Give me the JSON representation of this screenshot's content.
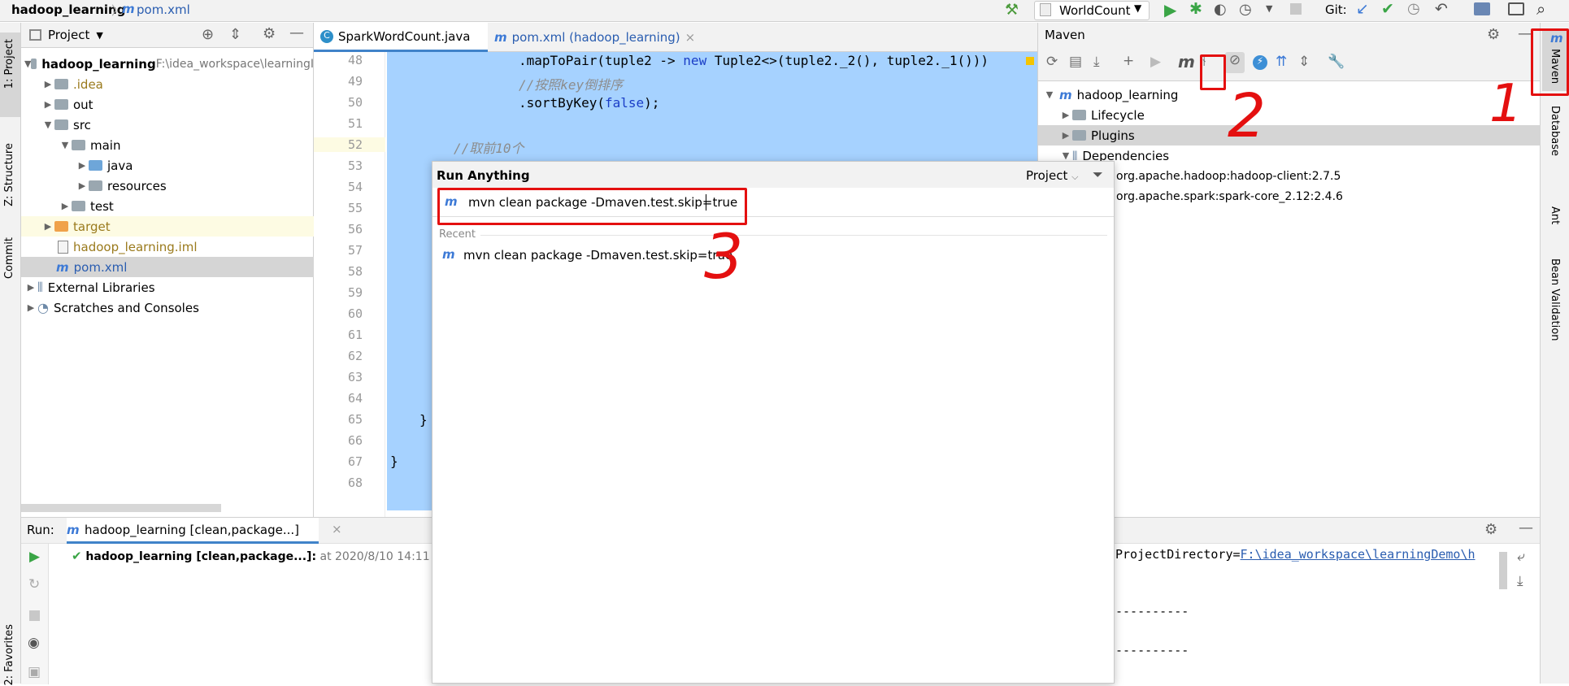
{
  "topbar": {
    "project": "hadoop_learning",
    "file": "pom.xml",
    "run_config": "WorldCount",
    "git_label": "Git:"
  },
  "left_tools": {
    "project": "1: Project",
    "structure": "Z: Structure",
    "commit": "Commit",
    "favorites": "2: Favorites"
  },
  "right_tools": {
    "maven": "Maven",
    "database": "Database",
    "ant": "Ant",
    "bean": "Bean Validation"
  },
  "project_panel": {
    "title": "Project",
    "items": [
      {
        "label": "hadoop_learning",
        "extra": "F:\\idea_workspace\\learningI",
        "indent": 0,
        "type": "module",
        "open": true
      },
      {
        "label": ".idea",
        "indent": 1,
        "type": "folder",
        "open": false
      },
      {
        "label": "out",
        "indent": 1,
        "type": "folder",
        "open": false
      },
      {
        "label": "src",
        "indent": 1,
        "type": "folder",
        "open": true
      },
      {
        "label": "main",
        "indent": 2,
        "type": "folder",
        "open": true
      },
      {
        "label": "java",
        "indent": 3,
        "type": "blue",
        "open": false
      },
      {
        "label": "resources",
        "indent": 3,
        "type": "folder",
        "open": false
      },
      {
        "label": "test",
        "indent": 2,
        "type": "folder",
        "open": false
      },
      {
        "label": "target",
        "indent": 1,
        "type": "orange",
        "open": false
      },
      {
        "label": "hadoop_learning.iml",
        "indent": 1,
        "type": "file"
      },
      {
        "label": "pom.xml",
        "indent": 1,
        "type": "maven"
      },
      {
        "label": "External Libraries",
        "indent": 0,
        "type": "lib",
        "open": false
      },
      {
        "label": "Scratches and Consoles",
        "indent": 0,
        "type": "scratch",
        "open": false
      }
    ]
  },
  "editor_tabs": [
    {
      "label": "SparkWordCount.java",
      "active": true
    },
    {
      "label": "pom.xml (hadoop_learning)",
      "active": false
    }
  ],
  "line_numbers": [
    "48",
    "49",
    "50",
    "51",
    "52",
    "53",
    "54",
    "55",
    "56",
    "57",
    "58",
    "59",
    "60",
    "61",
    "62",
    "63",
    "64",
    "65",
    "66",
    "67",
    "68"
  ],
  "code": {
    "l48_a": ".mapToPair(tuple2 -> ",
    "l48_kw": "new",
    "l48_b": " Tuple2<>(tuple2._2(), tuple2._1()))",
    "l49": "//按照key倒排序",
    "l50_a": ".sortByKey(",
    "l50_kw": "false",
    "l50_b": ");",
    "l52": "//取前10个",
    "l65": "}",
    "l67": "}"
  },
  "maven": {
    "title": "Maven",
    "tree": [
      {
        "label": "hadoop_learning",
        "indent": 0,
        "open": true
      },
      {
        "label": "Lifecycle",
        "indent": 1,
        "open": false
      },
      {
        "label": "Plugins",
        "indent": 1,
        "open": false
      },
      {
        "label": "Dependencies",
        "indent": 1,
        "open": true
      },
      {
        "label": "org.apache.hadoop:hadoop-client:2.7.5",
        "indent": 2
      },
      {
        "label": "org.apache.spark:spark-core_2.12:2.4.6",
        "indent": 2
      }
    ]
  },
  "run": {
    "label": "Run:",
    "tab": "hadoop_learning [clean,package...]",
    "entry_bold": "hadoop_learning [clean,package...]:",
    "entry_time": " at 2020/8/10 14:11",
    "console": {
      "l1_a": "ProjectDirectory=",
      "l1_link": "F:\\idea_workspace\\learningDemo\\h",
      "dash1": "----------",
      "dash2": "----------"
    }
  },
  "popup": {
    "title": "Run Anything",
    "scope": "Project",
    "input": "mvn clean package -Dmaven.test.skip=true",
    "recent_label": "Recent",
    "recent_item": "mvn clean package -Dmaven.test.skip=true"
  },
  "annotations": {
    "n1": "1",
    "n2": "2",
    "n3": "3",
    "color": "#e41010"
  }
}
